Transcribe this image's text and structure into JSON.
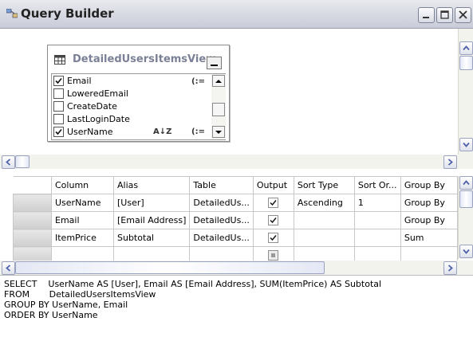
{
  "window": {
    "title": "Query Builder"
  },
  "diagram": {
    "table_name": "DetailedUsersItemsView",
    "columns": [
      {
        "name": "Email",
        "checked": true
      },
      {
        "name": "LoweredEmail",
        "checked": false
      },
      {
        "name": "CreateDate",
        "checked": false
      },
      {
        "name": "LastLoginDate",
        "checked": false
      },
      {
        "name": "UserName",
        "checked": true
      }
    ],
    "key_glyph": "(:=",
    "sort_glyph": "A↓Z"
  },
  "grid": {
    "headers": [
      "Column",
      "Alias",
      "Table",
      "Output",
      "Sort Type",
      "Sort Or...",
      "Group By"
    ],
    "rows": [
      {
        "column": "UserName",
        "alias": "[User]",
        "table": "DetailedUs...",
        "output": true,
        "sort_type": "Ascending",
        "sort_order": "1",
        "group_by": "Group By"
      },
      {
        "column": "Email",
        "alias": "[Email Address]",
        "table": "DetailedUs...",
        "output": true,
        "sort_type": "",
        "sort_order": "",
        "group_by": "Group By"
      },
      {
        "column": "ItemPrice",
        "alias": "Subtotal",
        "table": "DetailedUs...",
        "output": true,
        "sort_type": "",
        "sort_order": "",
        "group_by": "Sum"
      },
      {
        "column": "",
        "alias": "",
        "table": "",
        "output": null,
        "sort_type": "",
        "sort_order": "",
        "group_by": ""
      }
    ]
  },
  "sql": {
    "lines": [
      "SELECT    UserName AS [User], Email AS [Email Address], SUM(ItemPrice) AS Subtotal",
      "FROM       DetailedUsersItemsView",
      "GROUP BY UserName, Email",
      "ORDER BY UserName"
    ]
  },
  "colors": {
    "titlebar": "#c9ccd8",
    "scroll_arrow": "#4d61a8",
    "check": "#1a1a1a"
  }
}
